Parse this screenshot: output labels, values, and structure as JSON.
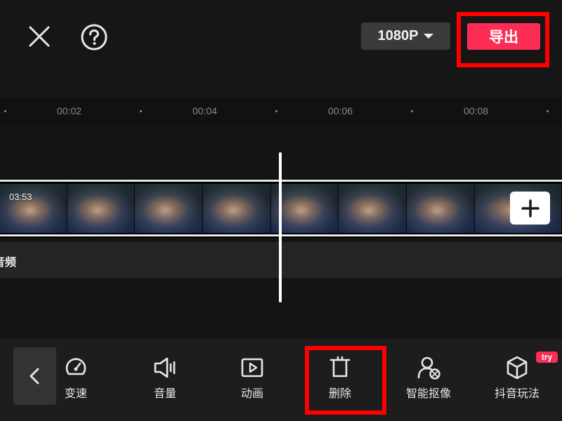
{
  "header": {
    "resolution_label": "1080P",
    "export_label": "导出"
  },
  "timeline": {
    "ruler_ticks": [
      "00:02",
      "00:04",
      "00:06",
      "00:08"
    ],
    "clip_duration": "03:53",
    "audio_label": "音频"
  },
  "toolbar": {
    "items": [
      {
        "label": "变速",
        "icon": "speed-gauge-icon"
      },
      {
        "label": "音量",
        "icon": "volume-icon"
      },
      {
        "label": "动画",
        "icon": "animation-play-icon"
      },
      {
        "label": "删除",
        "icon": "delete-icon"
      },
      {
        "label": "智能抠像",
        "icon": "smart-cutout-icon"
      },
      {
        "label": "抖音玩法",
        "icon": "cube-icon",
        "badge": "try"
      }
    ]
  },
  "colors": {
    "accent": "#fd2c55",
    "highlight_box": "#ff0000",
    "background": "#141414"
  }
}
